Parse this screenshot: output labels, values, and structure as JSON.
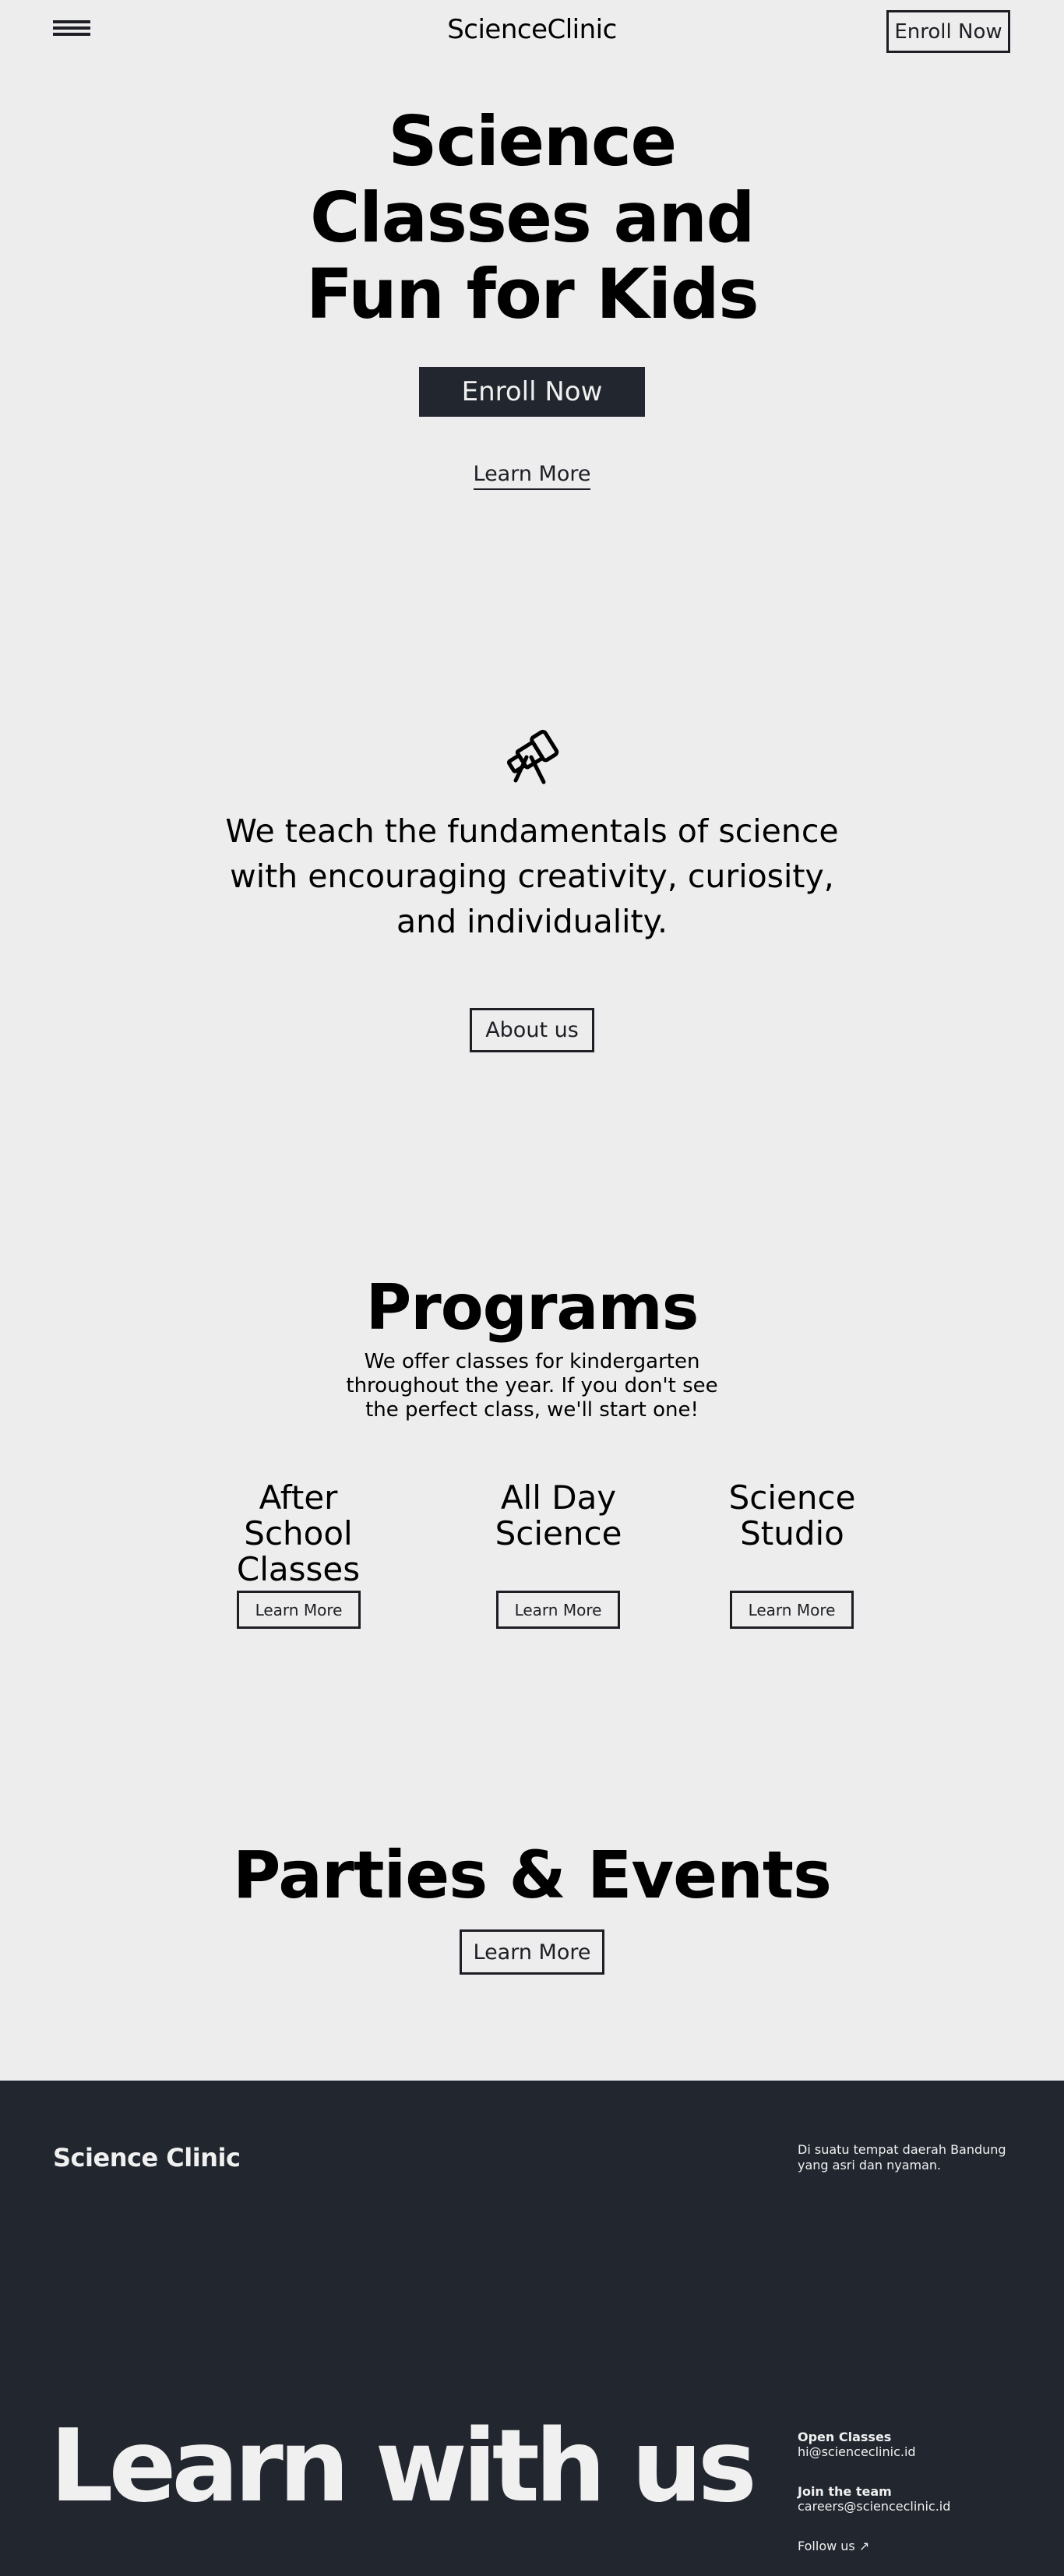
{
  "header": {
    "brand": "ScienceClinic",
    "enroll_label": "Enroll Now"
  },
  "hero": {
    "title_lines": [
      "Science",
      "Classes and",
      "Fun for Kids"
    ],
    "enroll_label": "Enroll Now",
    "learn_more_label": "Learn More"
  },
  "mission": {
    "icon": "telescope-icon",
    "text": "We teach the fundamentals of science with encouraging creativity, curiosity, and individuality.",
    "about_label": "About us"
  },
  "programs": {
    "title": "Programs",
    "subtitle": "We offer classes for kindergarten throughout the year. If you don't see the perfect class, we'll start one!",
    "items": [
      {
        "title_lines": [
          "After School",
          "Classes"
        ],
        "button": "Learn More"
      },
      {
        "title_lines": [
          "All Day",
          "Science"
        ],
        "button": "Learn More"
      },
      {
        "title_lines": [
          "Science",
          "Studio"
        ],
        "button": "Learn More"
      }
    ]
  },
  "parties": {
    "title": "Parties & Events",
    "button": "Learn More"
  },
  "footer": {
    "brand": "Science Clinic",
    "address": "Di suatu tempat daerah Bandung yang asri dan nyaman.",
    "headline": "Learn with us",
    "open_classes_label": "Open Classes",
    "open_classes_email": "hi@scienceclinic.id",
    "join_label": "Join the team",
    "join_email": "careers@scienceclinic.id",
    "follow_label": "Follow us ↗"
  },
  "colors": {
    "background": "#ededed",
    "dark": "#22272f",
    "text": "#000000"
  }
}
